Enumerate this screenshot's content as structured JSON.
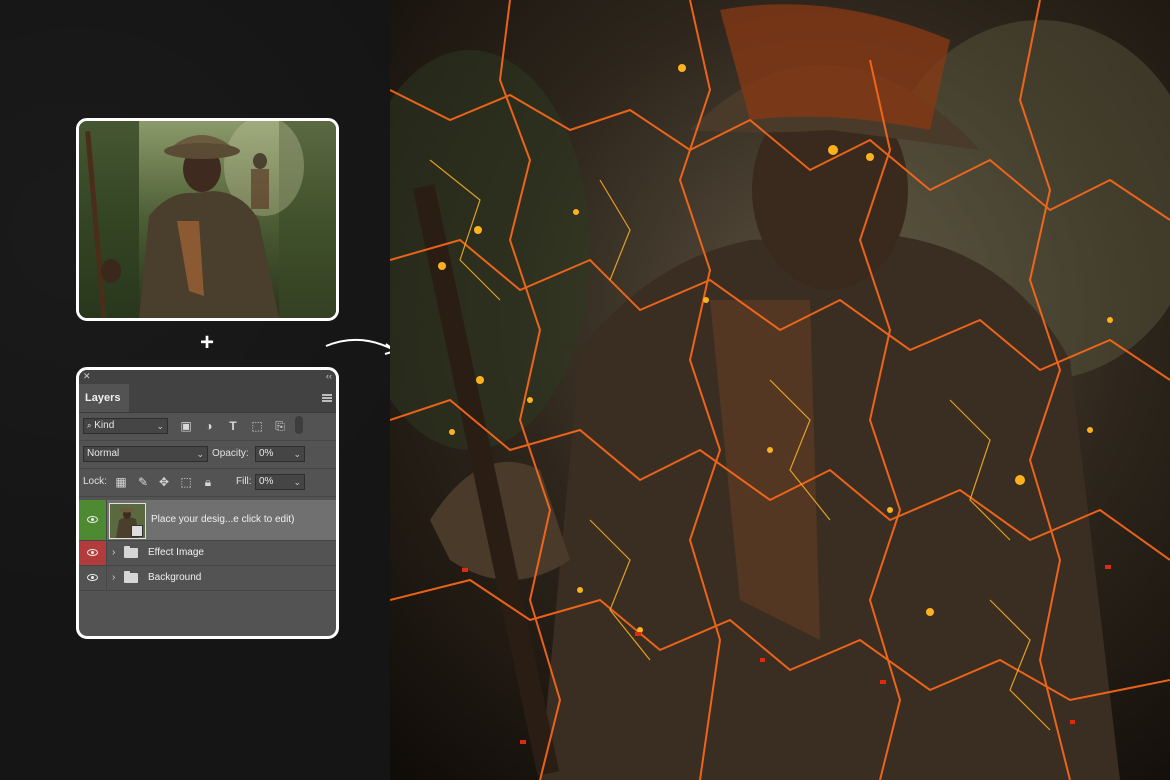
{
  "layers_panel": {
    "close_glyph": "✕",
    "collapse_glyph": "‹‹",
    "tab_label": "Layers",
    "filter": {
      "search_glyph": "🔍",
      "value": "Kind"
    },
    "blend_mode": "Normal",
    "opacity_label": "Opacity:",
    "opacity_value": "0%",
    "lock_label": "Lock:",
    "fill_label": "Fill:",
    "fill_value": "0%",
    "layers": [
      {
        "name": "Place your desig...e click to edit)",
        "type": "smart-object",
        "visible": true,
        "eye_color": "#4e8a31"
      },
      {
        "name": "Effect Image",
        "type": "group",
        "visible": true,
        "eye_color": "#b23b3b"
      },
      {
        "name": "Background",
        "type": "group",
        "visible": true
      }
    ]
  },
  "plus_glyph": "+",
  "icons": {
    "filter_icons": [
      "image-icon",
      "adjustment-icon",
      "type-icon",
      "shape-icon",
      "smart-object-icon",
      "toggle-icon"
    ],
    "lock_icons": [
      "lock-transparent-icon",
      "lock-paint-icon",
      "lock-move-icon",
      "lock-artboard-icon",
      "lock-all-icon"
    ]
  },
  "colors": {
    "background": "#141414",
    "panel": "#535353",
    "smart_layer_selected": "#707070",
    "lava": "#ff6a1a",
    "ember": "#ffb21f"
  }
}
